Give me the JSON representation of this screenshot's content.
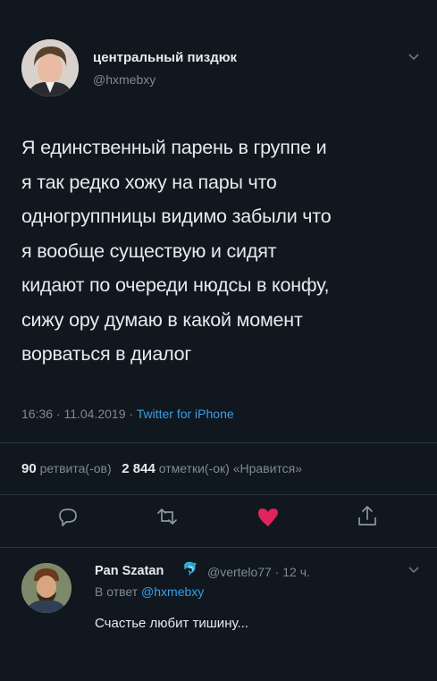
{
  "tweet": {
    "author_name": "центральный пиздюк",
    "author_handle": "@hxmebxy",
    "text": "Я единственный парень в группе и\nя так редко хожу на пары что\nодногруппницы видимо забыли что\nя вообще существую и сидят\nкидают по очереди нюдсы в конфу,\nсижу ору думаю в какой момент\nворваться в диалог",
    "time": "16:36 · 11.04.2019 · ",
    "source": "Twitter for iPhone",
    "retweets_count": "90",
    "retweets_label": "ретвита(-ов)",
    "likes_count": "2 844",
    "likes_label": "отметки(-ок) «Нравится»"
  },
  "actions": [
    "reply-icon",
    "retweet-icon",
    "like-icon",
    "share-icon"
  ],
  "colors": {
    "background": "#10171e",
    "accent": "#3a9ee8",
    "like": "#e0245e",
    "muted": "#7e8a95"
  },
  "reply": {
    "author_name": "Pan Szatan",
    "author_emoji": "🐬",
    "author_handle_time": "@vertelo77 · 12 ч.",
    "in_reply_prefix": "В ответ ",
    "in_reply_to": "@hxmebxy",
    "text": "Счастье любит тишину..."
  }
}
